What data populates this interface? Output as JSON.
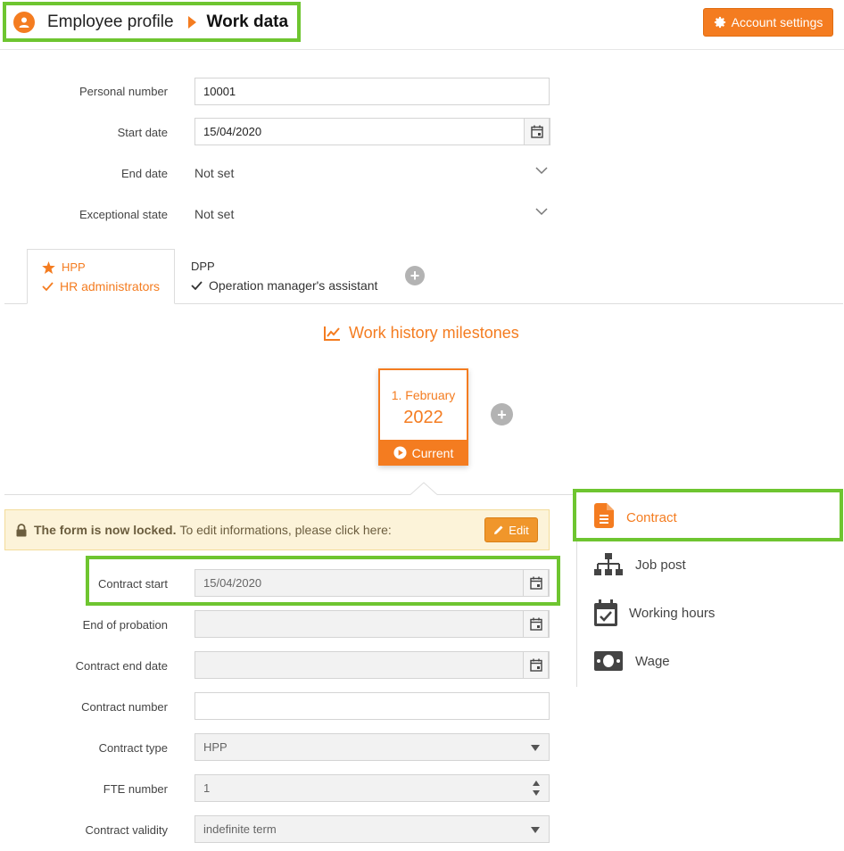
{
  "header": {
    "breadcrumb_parent": "Employee profile",
    "breadcrumb_current": "Work data",
    "account_settings_label": "Account settings"
  },
  "top_form": {
    "personal_number": {
      "label": "Personal number",
      "value": "10001"
    },
    "start_date": {
      "label": "Start date",
      "value": "15/04/2020"
    },
    "end_date": {
      "label": "End date",
      "value": "Not set"
    },
    "exceptional_state": {
      "label": "Exceptional state",
      "value": "Not set"
    }
  },
  "tabs": [
    {
      "title": "HPP",
      "subtitle": "HR administrators",
      "active": true
    },
    {
      "title": "DPP",
      "subtitle": "Operation manager's assistant",
      "active": false
    }
  ],
  "milestones": {
    "title": "Work history milestones",
    "card": {
      "day": "1. February",
      "year": "2022",
      "status": "Current"
    }
  },
  "locked_banner": {
    "bold": "The form is now locked.",
    "text": "To edit informations, please click here:",
    "edit_label": "Edit"
  },
  "contract_form": {
    "contract_start": {
      "label": "Contract start",
      "value": "15/04/2020"
    },
    "end_of_probation": {
      "label": "End of probation",
      "value": ""
    },
    "contract_end_date": {
      "label": "Contract end date",
      "value": ""
    },
    "contract_number": {
      "label": "Contract number",
      "value": ""
    },
    "contract_type": {
      "label": "Contract type",
      "value": "HPP"
    },
    "fte_number": {
      "label": "FTE number",
      "value": "1"
    },
    "contract_validity": {
      "label": "Contract validity",
      "value": "indefinite term"
    }
  },
  "side_nav": [
    {
      "label": "Contract",
      "icon": "document-icon",
      "active": true
    },
    {
      "label": "Job post",
      "icon": "org-chart-icon",
      "active": false
    },
    {
      "label": "Working hours",
      "icon": "calendar-check-icon",
      "active": false
    },
    {
      "label": "Wage",
      "icon": "banknote-icon",
      "active": false
    }
  ],
  "colors": {
    "accent": "#f47c20",
    "highlight": "#6ec530",
    "locked_bg": "#fcf3d9"
  }
}
